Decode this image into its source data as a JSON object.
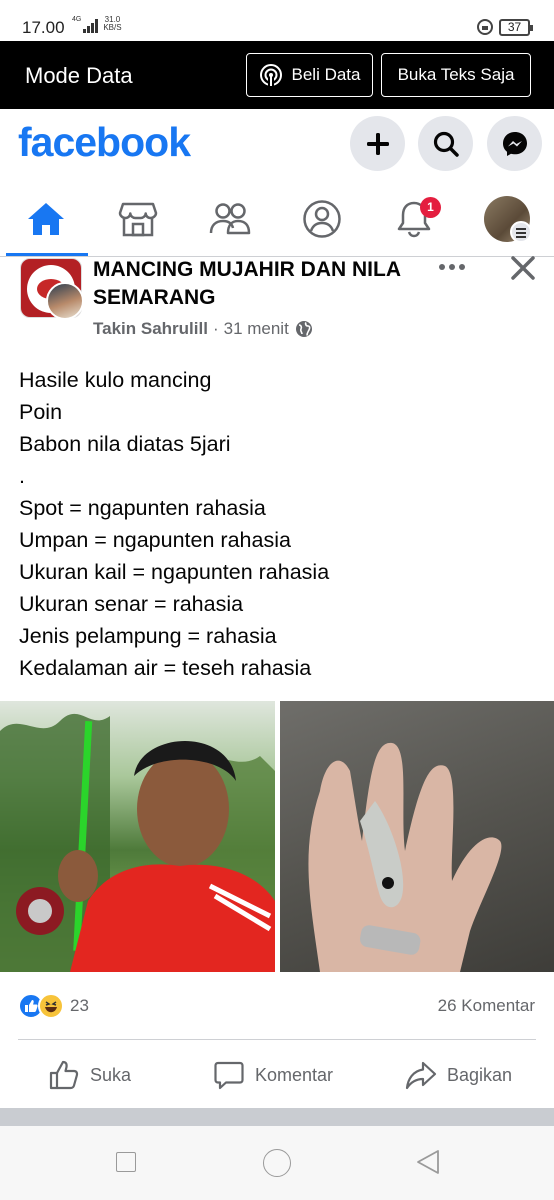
{
  "status_bar": {
    "time": "17.00",
    "network_label": "4G",
    "speed_value": "31.0",
    "speed_unit": "KB/S",
    "battery": "37"
  },
  "mode_bar": {
    "title": "Mode Data",
    "buy_data_label": "Beli Data",
    "text_only_label": "Buka Teks Saja"
  },
  "header": {
    "logo": "facebook",
    "brand_color": "#1877f2",
    "icons": [
      "plus-icon",
      "search-icon",
      "messenger-icon"
    ]
  },
  "tabs": {
    "items": [
      "home",
      "marketplace",
      "groups",
      "profile",
      "notifications",
      "menu"
    ],
    "active": "home",
    "notification_badge": "1"
  },
  "post": {
    "group_name": "MANCING MUJAHIR DAN NILA SEMARANG",
    "author": "Takin Sahrulill",
    "time": "31 menit",
    "separator": "·",
    "text_lines": [
      "Hasile kulo mancing",
      "Poin",
      "Babon nila diatas 5jari",
      ".",
      "Spot = ngapunten rahasia",
      "Umpan = ngapunten rahasia",
      "Ukuran kail = ngapunten rahasia",
      "Ukuran senar = rahasia",
      "Jenis pelampung = rahasia",
      "Kedalaman air = teseh rahasia"
    ],
    "reaction_count": "23",
    "comment_count": "26 Komentar",
    "actions": {
      "like": "Suka",
      "comment": "Komentar",
      "share": "Bagikan"
    }
  }
}
